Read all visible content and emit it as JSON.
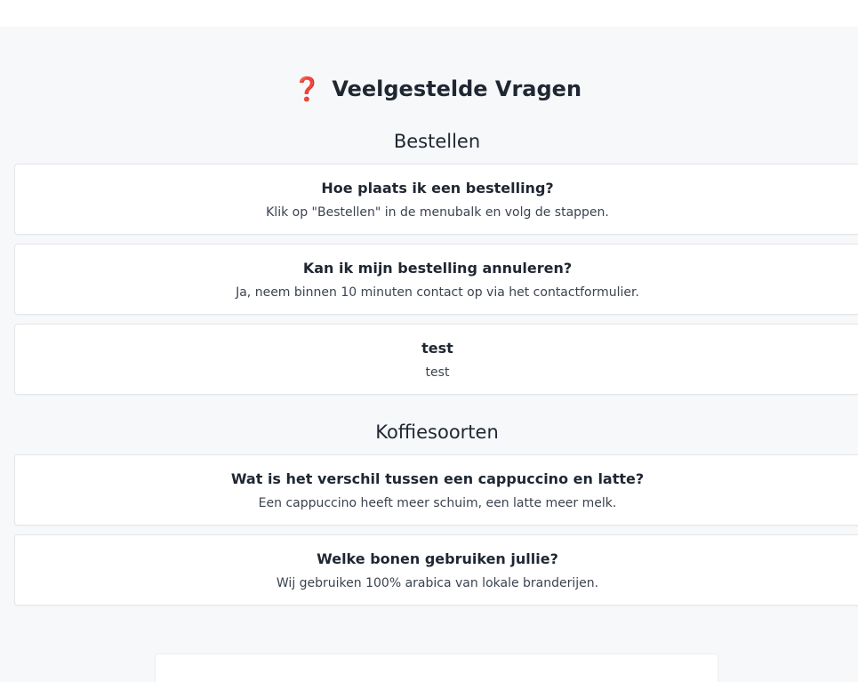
{
  "page": {
    "title": "Veelgestelde Vragen",
    "title_icon": "question-mark-icon",
    "accent_color": "#e63f5f"
  },
  "sections": [
    {
      "title": "Bestellen",
      "items": [
        {
          "question": "Hoe plaats ik een bestelling?",
          "answer": "Klik op \"Bestellen\" in de menubalk en volg de stappen."
        },
        {
          "question": "Kan ik mijn bestelling annuleren?",
          "answer": "Ja, neem binnen 10 minuten contact op via het contactformulier."
        },
        {
          "question": "test",
          "answer": "test"
        }
      ]
    },
    {
      "title": "Koffiesoorten",
      "items": [
        {
          "question": "Wat is het verschil tussen een cappuccino en latte?",
          "answer": "Een cappuccino heeft meer schuim, een latte meer melk."
        },
        {
          "question": "Welke bonen gebruiken jullie?",
          "answer": "Wij gebruiken 100% arabica van lokale branderijen."
        }
      ]
    }
  ]
}
